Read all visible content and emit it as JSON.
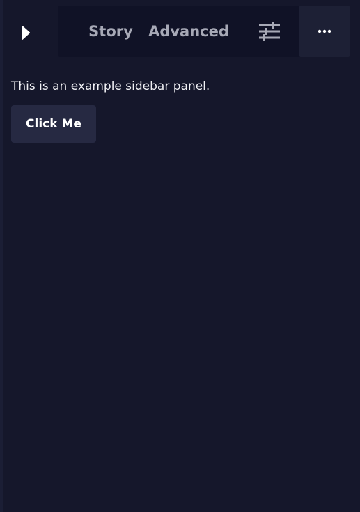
{
  "header": {
    "play_icon": "play-icon",
    "tabs": [
      {
        "label": "Story"
      },
      {
        "label": "Advanced"
      }
    ],
    "settings_icon": "sliders-icon",
    "more_icon": "ellipsis-icon"
  },
  "sidebar": {
    "description": "This is an example sidebar panel.",
    "button_label": "Click Me"
  },
  "colors": {
    "background": "#15172b",
    "tabbar_background": "#101226",
    "button_background": "#262942",
    "tab_text": "#a7a9b6",
    "text": "#f1f1f5"
  }
}
